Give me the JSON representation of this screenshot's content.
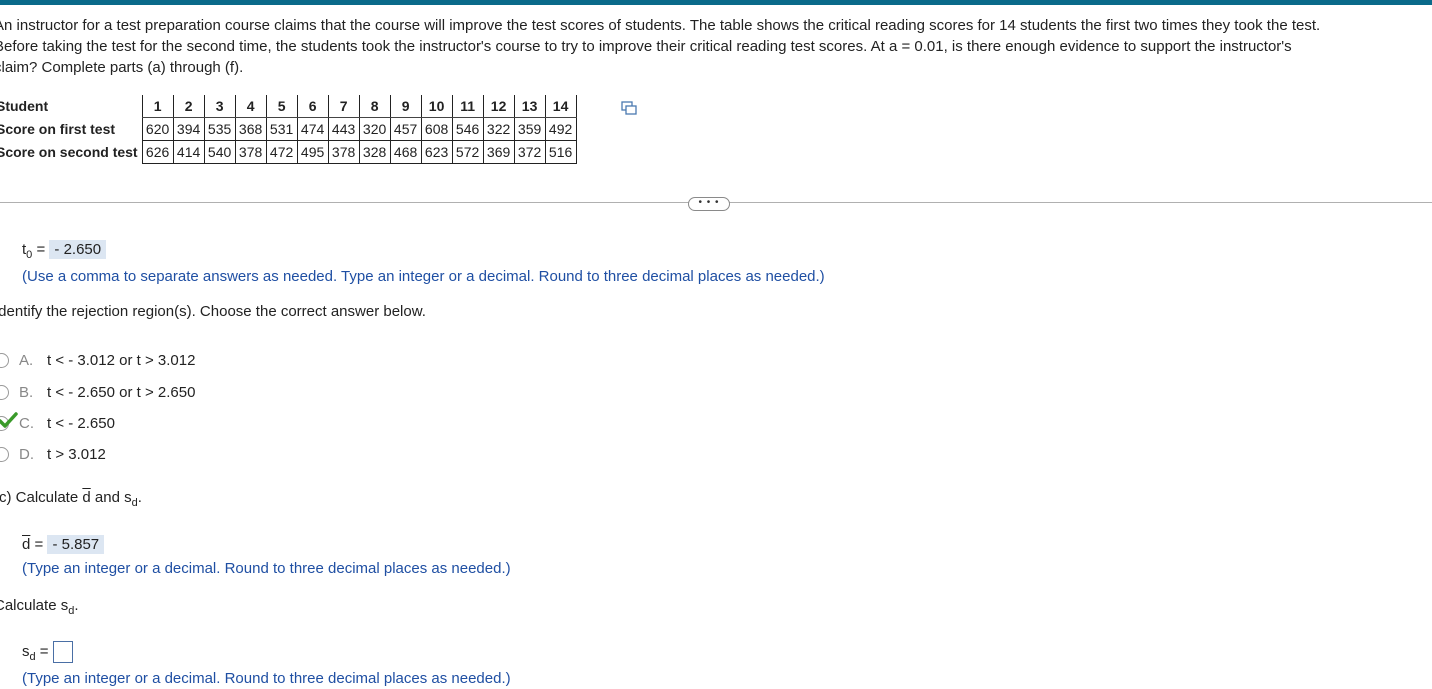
{
  "problem": {
    "line1": "An instructor for a test preparation course claims that the course will improve the test scores of students. The table shows the critical reading scores for 14 students the first two times they took the test.",
    "line2": "Before taking the test for the second time, the students took the instructor's course to try to improve their critical reading test scores. At a = 0.01, is there enough evidence to support the instructor's",
    "line3": "claim? Complete parts (a) through (f)."
  },
  "table": {
    "row_labels": [
      "Student",
      "Score on first test",
      "Score on second test"
    ],
    "students": [
      "1",
      "2",
      "3",
      "4",
      "5",
      "6",
      "7",
      "8",
      "9",
      "10",
      "11",
      "12",
      "13",
      "14"
    ],
    "first_test": [
      "620",
      "394",
      "535",
      "368",
      "531",
      "474",
      "443",
      "320",
      "457",
      "608",
      "546",
      "322",
      "359",
      "492"
    ],
    "second_test": [
      "626",
      "414",
      "540",
      "378",
      "472",
      "495",
      "378",
      "328",
      "468",
      "623",
      "572",
      "369",
      "372",
      "516"
    ]
  },
  "more_button_label": "• • •",
  "test_statistic": {
    "label": "t",
    "subscript": "0",
    "equals": "=",
    "value": "- 2.650",
    "hint": "(Use a comma to separate answers as needed. Type an integer or a decimal. Round to three decimal places as needed.)"
  },
  "rejection": {
    "prompt": "Identify the rejection region(s). Choose the correct answer below.",
    "options": [
      {
        "letter": "A.",
        "text": "t < - 3.012 or t > 3.012"
      },
      {
        "letter": "B.",
        "text": "t < - 2.650 or t > 2.650"
      },
      {
        "letter": "C.",
        "text": "t < - 2.650"
      },
      {
        "letter": "D.",
        "text": "t > 3.012"
      }
    ],
    "selected": "C."
  },
  "part_c": {
    "prompt_pre": "(c) Calculate",
    "d_bar": "d",
    "and": "and",
    "s": "s",
    "sub_d": "d",
    "period": ".",
    "dbar_equals": "=",
    "dbar_value": "- 5.857",
    "dbar_hint": "(Type an integer or a decimal. Round to three decimal places as needed.)",
    "sd_prompt": "Calculate",
    "sd_equals": "=",
    "sd_value": "",
    "sd_hint": "(Type an integer or a decimal. Round to three decimal places as needed.)"
  },
  "colors": {
    "accent_bar": "#0a6a8a",
    "answer_highlight": "#dce6f2",
    "hint_text": "#1f4fa3",
    "check": "#3a9a2a"
  }
}
